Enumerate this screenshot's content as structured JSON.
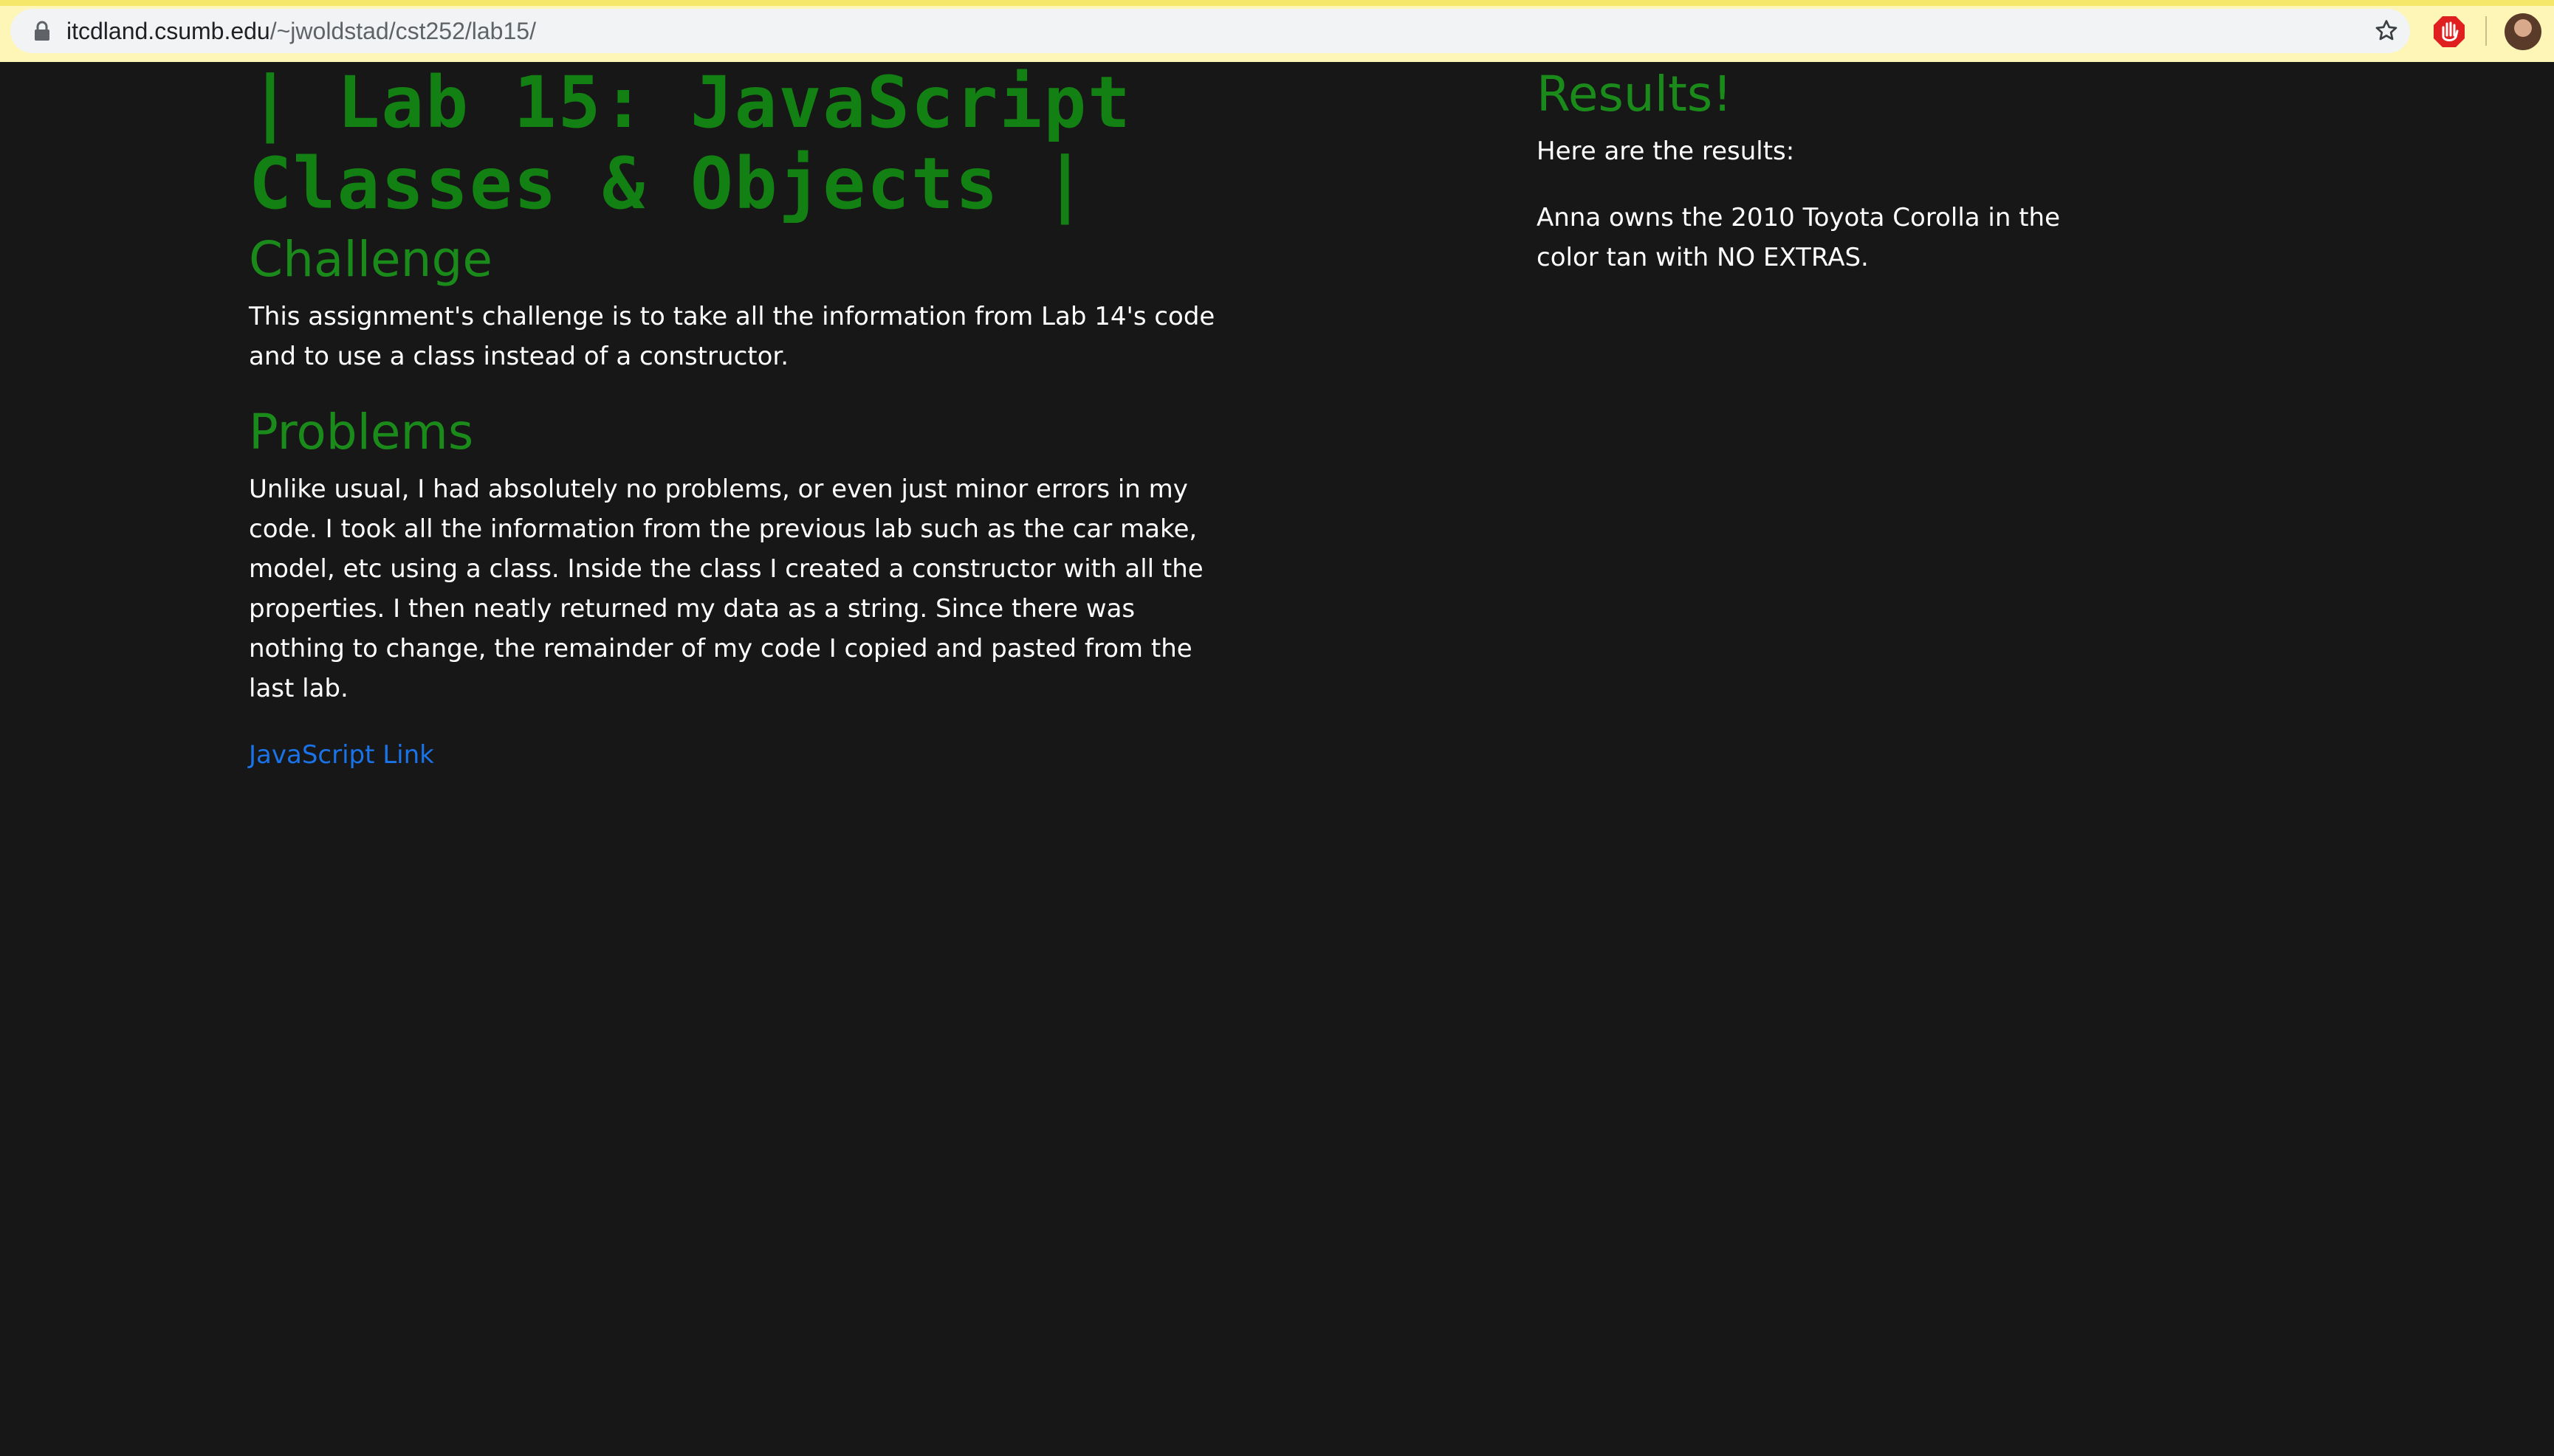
{
  "browser": {
    "url_host": "itcdland.csumb.edu",
    "url_path": "/~jwoldstad/cst252/lab15/"
  },
  "main": {
    "title": "| Lab 15: JavaScript Classes & Objects |",
    "challenge_heading": "Challenge",
    "challenge_text": "This assignment's challenge is to take all the information from Lab 14's code and to use a class instead of a constructor.",
    "problems_heading": "Problems",
    "problems_text": "Unlike usual, I had absolutely no problems, or even just minor errors in my code. I took all the information from the previous lab such as the car make, model, etc using a class. Inside the class I created a constructor with all the properties. I then neatly returned my data as a string. Since there was nothing to change, the remainder of my code I copied and pasted from the last lab.",
    "link_label": "JavaScript Link"
  },
  "results": {
    "heading": "Results!",
    "intro": "Here are the results:",
    "output": "Anna owns the 2010 Toyota Corolla in the color tan with NO EXTRAS."
  },
  "colors": {
    "background": "#171717",
    "heading_green": "#128012",
    "link_blue": "#1a73e8",
    "text": "#ffffff"
  }
}
